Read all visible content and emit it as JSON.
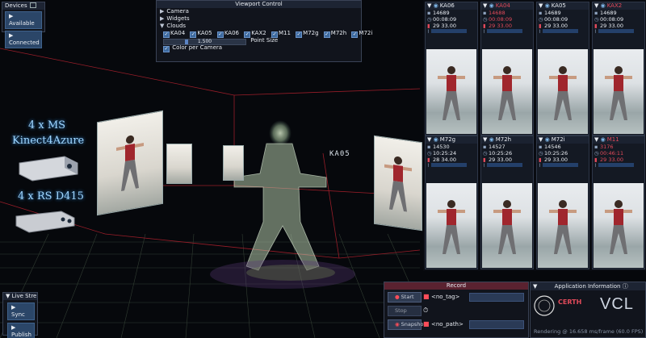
{
  "devices": {
    "title": "Devices",
    "available_label": "Available",
    "connected_label": "Connected"
  },
  "viewport_control": {
    "title": "Viewport Control",
    "camera_label": "Camera",
    "widgets_label": "Widgets",
    "clouds_label": "Clouds",
    "clouds": [
      "KA04",
      "KA05",
      "KA06",
      "KAX2",
      "M11",
      "M72g",
      "M72h",
      "M72i"
    ],
    "point_size_value": "1.500",
    "point_size_label": "Point Size",
    "color_per_camera_label": "Color per Camera"
  },
  "overlay_labels": {
    "ms": "4 x MS",
    "kinect": "Kinect4Azure",
    "rs": "4 x RS D415",
    "ka05": "KA05"
  },
  "cameras": [
    {
      "name": "KA06",
      "frame": "14689",
      "time": "00:08:09",
      "fps1": "29",
      "fps2": "33.00",
      "name_color": "#e8ecf2",
      "val_color": "#e8ecf2"
    },
    {
      "name": "KA04",
      "frame": "14688",
      "time": "00:08:09",
      "fps1": "29",
      "fps2": "33.00",
      "name_color": "#e24a5a",
      "val_color": "#e24a5a"
    },
    {
      "name": "KA05",
      "frame": "14689",
      "time": "00:08:09",
      "fps1": "29",
      "fps2": "33.00",
      "name_color": "#e8ecf2",
      "val_color": "#e8ecf2"
    },
    {
      "name": "KAX2",
      "frame": "14689",
      "time": "00:08:09",
      "fps1": "29",
      "fps2": "33.00",
      "name_color": "#e24a5a",
      "val_color": "#e8ecf2"
    },
    {
      "name": "M72g",
      "frame": "14530",
      "time": "10:25:24",
      "fps1": "28",
      "fps2": "34.00",
      "name_color": "#e8ecf2",
      "val_color": "#e8ecf2"
    },
    {
      "name": "M72h",
      "frame": "14527",
      "time": "10:25:26",
      "fps1": "29",
      "fps2": "33.00",
      "name_color": "#e8ecf2",
      "val_color": "#e8ecf2"
    },
    {
      "name": "M72i",
      "frame": "14546",
      "time": "10:25:26",
      "fps1": "29",
      "fps2": "33.00",
      "name_color": "#e8ecf2",
      "val_color": "#e8ecf2"
    },
    {
      "name": "M11",
      "frame": "3176",
      "time": "00:46:11",
      "fps1": "29",
      "fps2": "33.00",
      "name_color": "#e24a5a",
      "val_color": "#e24a5a"
    }
  ],
  "live_stream": {
    "title": "Live Stre",
    "sync_label": "Sync",
    "publish_label": "Publish"
  },
  "record": {
    "title": "Record",
    "start_label": "Start",
    "stop_label": "Stop",
    "snapshot_label": "Snapshot",
    "tag_text": "<no_tag>",
    "path_text": "<no_path>"
  },
  "app_info": {
    "title": "Application Information",
    "lab_name": "VCL",
    "institute_name": "CERTH",
    "rendering_text": "Rendering @ 16.658 ms/frame (60.0 FPS)"
  },
  "colors": {
    "accent": "#3d6aa0",
    "record_header": "#5a2230",
    "highlight_red": "#e24a5a"
  }
}
